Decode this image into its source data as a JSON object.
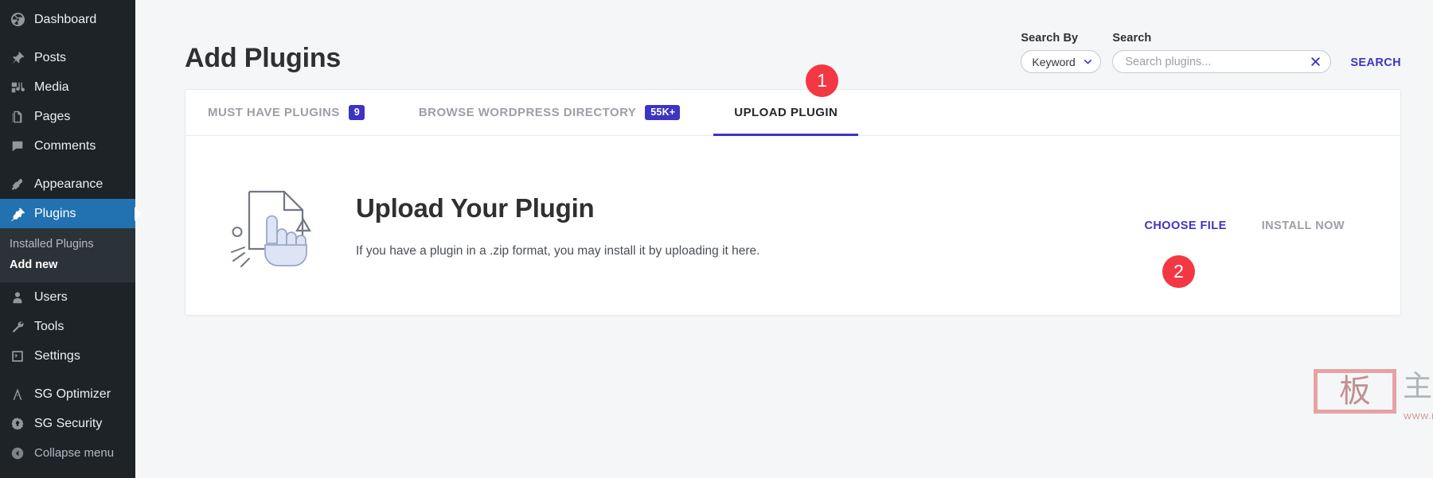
{
  "sidebar": {
    "items": [
      {
        "label": "Dashboard",
        "icon": "dashboard-icon",
        "gap_after": true
      },
      {
        "label": "Posts",
        "icon": "pin-icon"
      },
      {
        "label": "Media",
        "icon": "media-icon"
      },
      {
        "label": "Pages",
        "icon": "pages-icon"
      },
      {
        "label": "Comments",
        "icon": "comment-icon",
        "gap_after": true
      },
      {
        "label": "Appearance",
        "icon": "brush-icon"
      },
      {
        "label": "Plugins",
        "icon": "plug-icon",
        "active": true
      }
    ],
    "submenu": [
      {
        "label": "Installed Plugins",
        "current": false
      },
      {
        "label": "Add new",
        "current": true
      }
    ],
    "items_after": [
      {
        "label": "Users",
        "icon": "user-icon"
      },
      {
        "label": "Tools",
        "icon": "wrench-icon"
      },
      {
        "label": "Settings",
        "icon": "settings-icon",
        "gap_after": true
      },
      {
        "label": "SG Optimizer",
        "icon": "sg-optimizer-icon"
      },
      {
        "label": "SG Security",
        "icon": "sg-security-icon"
      }
    ],
    "collapse": {
      "label": "Collapse menu",
      "icon": "collapse-arrow-icon"
    }
  },
  "header": {
    "title": "Add Plugins",
    "search_by_label": "Search By",
    "search_by_value": "Keyword",
    "search_by_options": [
      "Keyword"
    ],
    "search_label": "Search",
    "search_value": "",
    "search_placeholder": "Search plugins...",
    "clear_icon": "close-icon",
    "search_button": "SEARCH"
  },
  "tabs": [
    {
      "label": "MUST HAVE PLUGINS",
      "badge": "9",
      "active": false
    },
    {
      "label": "BROWSE WORDPRESS DIRECTORY",
      "badge": "55K+",
      "active": false
    },
    {
      "label": "UPLOAD PLUGIN",
      "badge": "",
      "active": true
    }
  ],
  "upload": {
    "icon": "document-hand-pointer-icon",
    "title": "Upload Your Plugin",
    "description": "If you have a plugin in a .zip format, you may install it by uploading it here.",
    "choose_file_label": "CHOOSE FILE",
    "install_now_label": "INSTALL NOW"
  },
  "markers": [
    {
      "number": "1"
    },
    {
      "number": "2"
    }
  ],
  "watermark": {
    "seal_char": "板",
    "chars": "主题",
    "url": "WWW.BANZHUTI.COM"
  },
  "colors": {
    "accent_indigo": "#3d34c4",
    "sidebar_bg": "#1d2327",
    "sidebar_active": "#2271b1",
    "marker_red": "#f33843",
    "muted_text": "#9c9fa5"
  }
}
